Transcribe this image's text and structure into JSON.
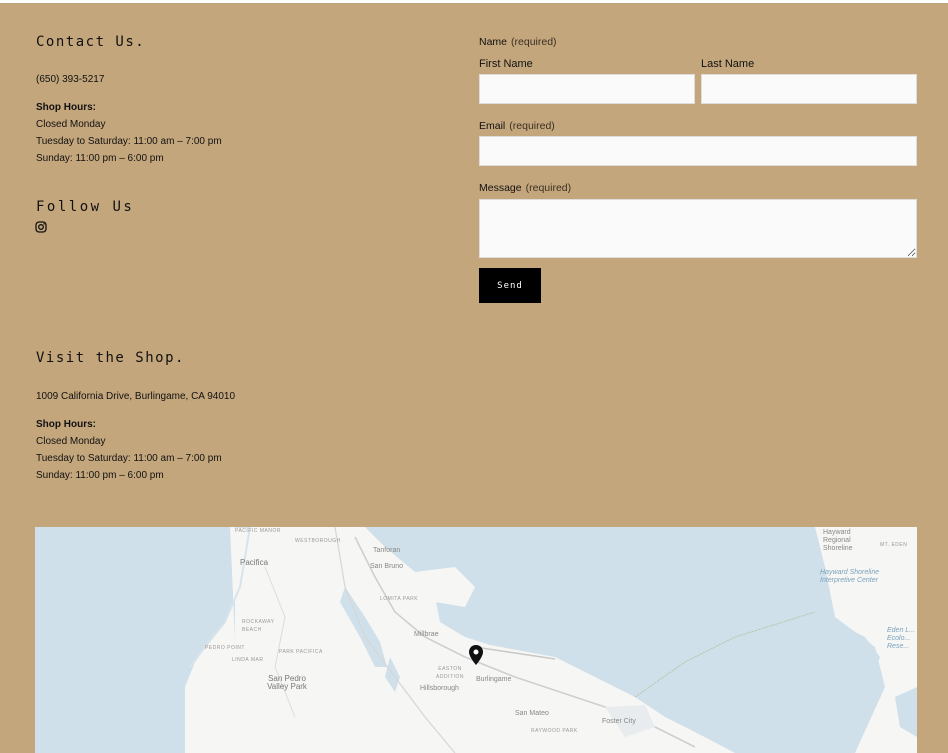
{
  "contact": {
    "heading": "Contact Us.",
    "phone": "(650) 393-5217",
    "hours_title": "Shop Hours:",
    "hours": [
      "Closed Monday",
      "Tuesday to Saturday: 11:00 am – 7:00 pm",
      "Sunday: 11:00 pm – 6:00 pm"
    ]
  },
  "follow": {
    "heading": "Follow Us",
    "icon": "instagram-icon"
  },
  "visit": {
    "heading": "Visit the Shop.",
    "address": "1009 California Drive, Burlingame, CA 94010",
    "hours_title": "Shop Hours:",
    "hours": [
      "Closed Monday",
      "Tuesday to Saturday: 11:00 am – 7:00 pm",
      "Sunday: 11:00 pm – 6:00 pm"
    ]
  },
  "form": {
    "name_label": "Name",
    "name_required": "(required)",
    "first_name_label": "First Name",
    "first_name_value": "",
    "last_name_label": "Last Name",
    "last_name_value": "",
    "email_label": "Email",
    "email_required": "(required)",
    "email_value": "",
    "message_label": "Message",
    "message_required": "(required)",
    "message_value": "",
    "send_label": "Send"
  },
  "map": {
    "labels": {
      "pacific_manor": "PACIFIC MANOR",
      "westborough": "WESTBOROUGH",
      "tanforan": "Tanforan",
      "san_bruno": "San Bruno",
      "pacifica": "Pacifica",
      "lomita_park": "LOMITA PARK",
      "rockaway_beach": "ROCKAWAY BEACH",
      "pedro_point": "PEDRO POINT",
      "park_pacifica": "PARK PACIFICA",
      "linda_mar": "LINDA MAR",
      "millbrae": "Millbrae",
      "easton_addition": "EASTON ADDITION",
      "burlingame": "Burlingame",
      "hillsborough": "Hillsborough",
      "san_pedro_valley_park": "San Pedro Valley Park",
      "san_mateo": "San Mateo",
      "raywood_park": "RAYWOOD PARK",
      "foster_city": "Foster City",
      "hayward_regional_shoreline": "Hayward Regional Shoreline",
      "mt_eden": "MT. EDEN",
      "hayward_shoreline_center": "Hayward Shoreline Interpretive Center",
      "eden_landing": "Eden L... Ecolo... Rese..."
    },
    "colors": {
      "water": "#cfe0ea",
      "land": "#f6f6f4",
      "pin": "#111111"
    }
  }
}
